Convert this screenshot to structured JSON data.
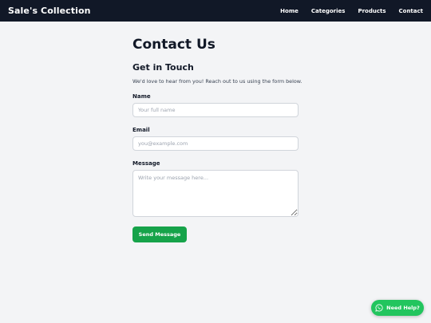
{
  "nav": {
    "brand": "Sale's Collection",
    "links": [
      "Home",
      "Categories",
      "Products",
      "Contact"
    ]
  },
  "page": {
    "title": "Contact Us",
    "section_title": "Get in Touch",
    "intro": "We'd love to hear from you! Reach out to us using the form below."
  },
  "form": {
    "name_label": "Name",
    "name_placeholder": "Your full name",
    "email_label": "Email",
    "email_placeholder": "you@example.com",
    "message_label": "Message",
    "message_placeholder": "Write your message here...",
    "submit_label": "Send Message"
  },
  "help": {
    "label": "Need Help?",
    "icon": "whatsapp-icon"
  },
  "colors": {
    "navbar": "#111827",
    "accent": "#16a34a",
    "help": "#22c55e",
    "background": "#f3f4f6"
  }
}
